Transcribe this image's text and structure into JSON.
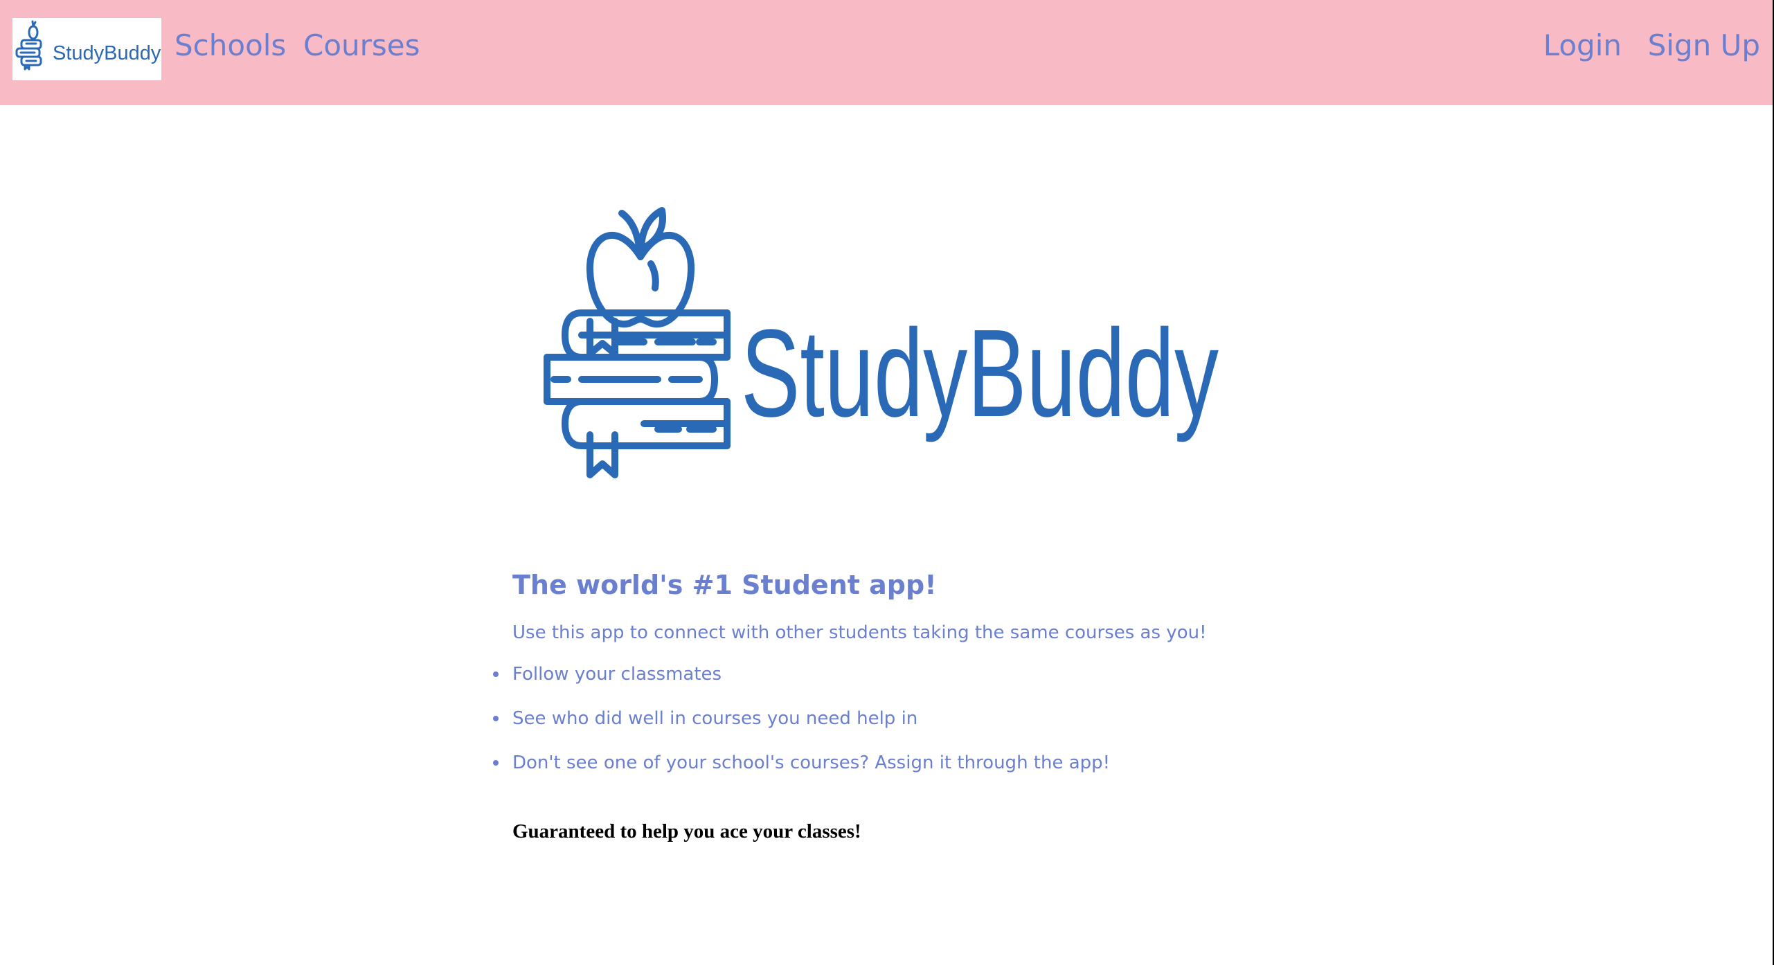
{
  "nav": {
    "logo_text": "StudyBuddy",
    "links": [
      "Schools",
      "Courses"
    ],
    "auth": {
      "login": "Login",
      "signup": "Sign Up"
    }
  },
  "hero": {
    "logo_text": "StudyBuddy",
    "logo_icon": "apple-on-books-icon"
  },
  "content": {
    "headline": "The world's #1 Student app!",
    "intro": "Use this app to connect with other students taking the same courses as you!",
    "features": [
      "Follow your classmates",
      "See who did well in courses you need help in",
      "Don't see one of your school's courses? Assign it through the app!"
    ],
    "guarantee": "Guaranteed to help you ace your classes!"
  },
  "colors": {
    "navbar_bg": "#f8bbc5",
    "accent": "#6a7fd0",
    "logo_blue": "#2a69b5"
  }
}
